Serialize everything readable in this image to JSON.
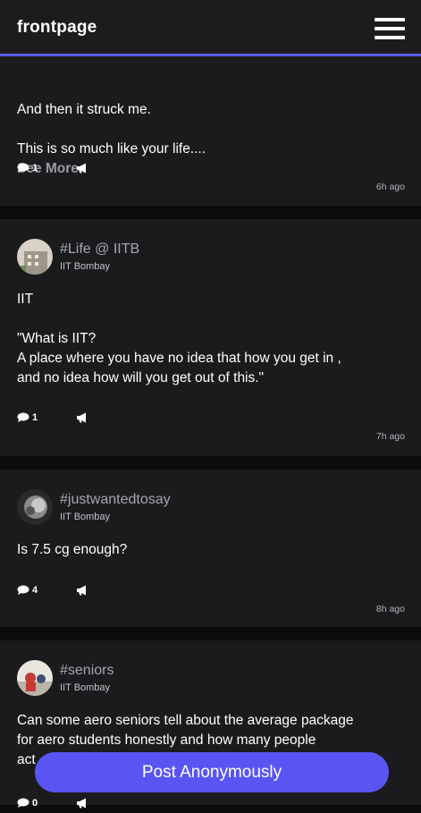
{
  "app": {
    "title": "frontpage"
  },
  "posts": [
    {
      "tag": "",
      "org": "",
      "text": "And then it struck me.\n\nThis is so much like your life....",
      "see_more": "See More",
      "comments": "1",
      "time": "6h ago"
    },
    {
      "tag": "#Life @ IITB",
      "org": "IIT Bombay",
      "text": "IIT\n\n\"What is IIT?\nA place where you have no idea that how you get in ,\nand no idea how will you get out of this.\"",
      "comments": "1",
      "time": "7h ago"
    },
    {
      "tag": "#justwantedtosay",
      "org": "IIT Bombay",
      "text": "Is 7.5 cg enough?",
      "comments": "4",
      "time": "8h ago"
    },
    {
      "tag": "#seniors",
      "org": "IIT Bombay",
      "text": "Can some aero seniors tell about the average package\nfor aero students honestly and how many people\nact",
      "comments": "0",
      "time": ""
    }
  ],
  "fab": {
    "label": "Post Anonymously"
  },
  "colors": {
    "accent": "#5b58f0",
    "card": "#1b1b1e",
    "background": "#0b0b0d"
  }
}
